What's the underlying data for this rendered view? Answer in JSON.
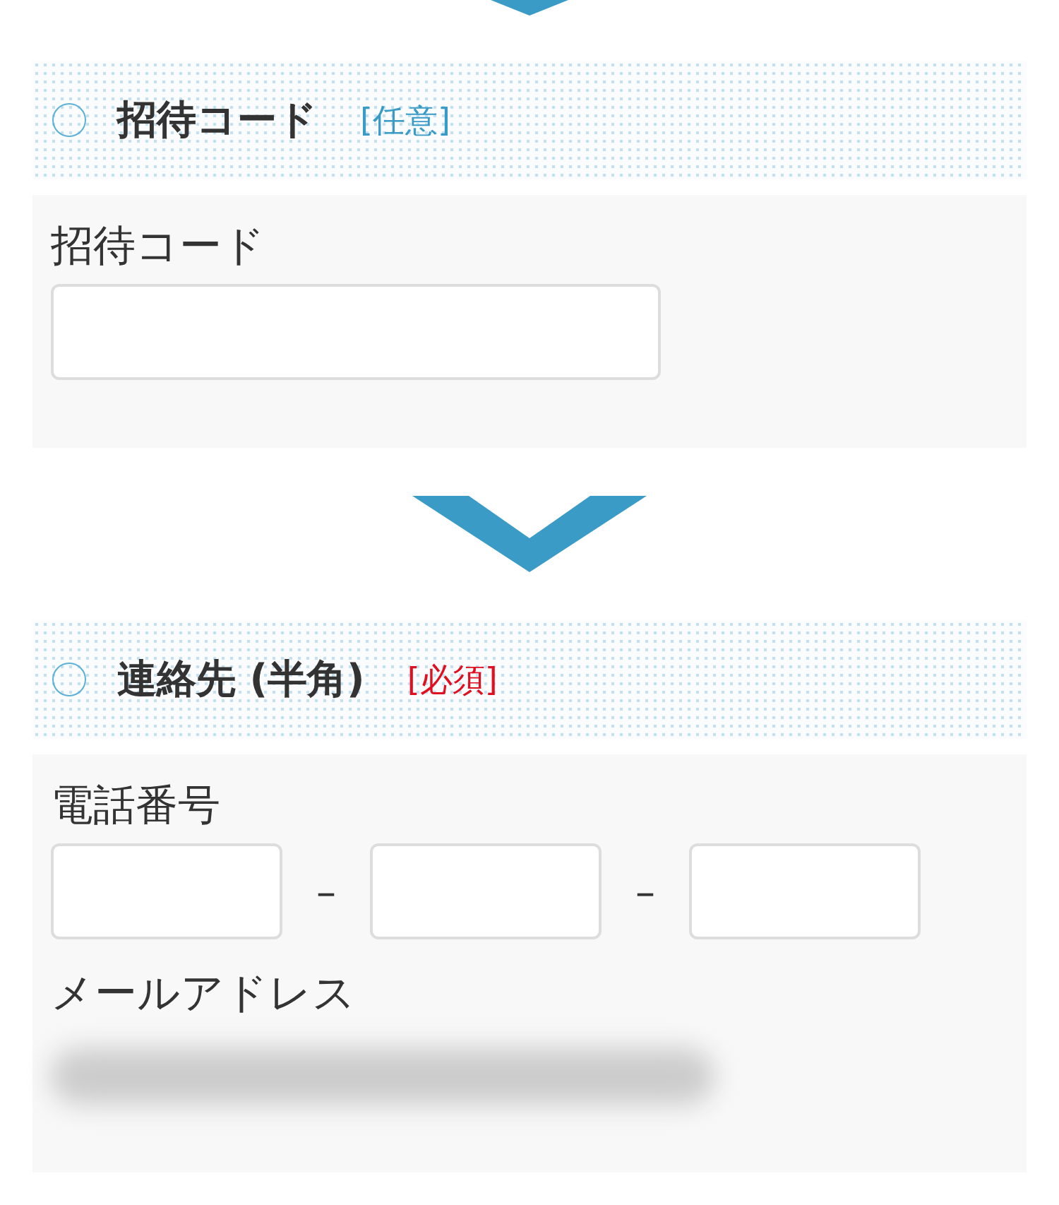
{
  "sections": [
    {
      "title": "招待コード",
      "tag": {
        "kind": "optional",
        "text": "[任意]"
      },
      "fields": [
        {
          "kind": "text",
          "label": "招待コード"
        }
      ]
    },
    {
      "title": "連絡先 (半角)",
      "tag": {
        "kind": "required",
        "text": "[必須]"
      },
      "fields": [
        {
          "kind": "phone",
          "label": "電話番号",
          "separators": [
            "–",
            "–"
          ]
        },
        {
          "kind": "redacted",
          "label": "メールアドレス"
        }
      ]
    }
  ]
}
